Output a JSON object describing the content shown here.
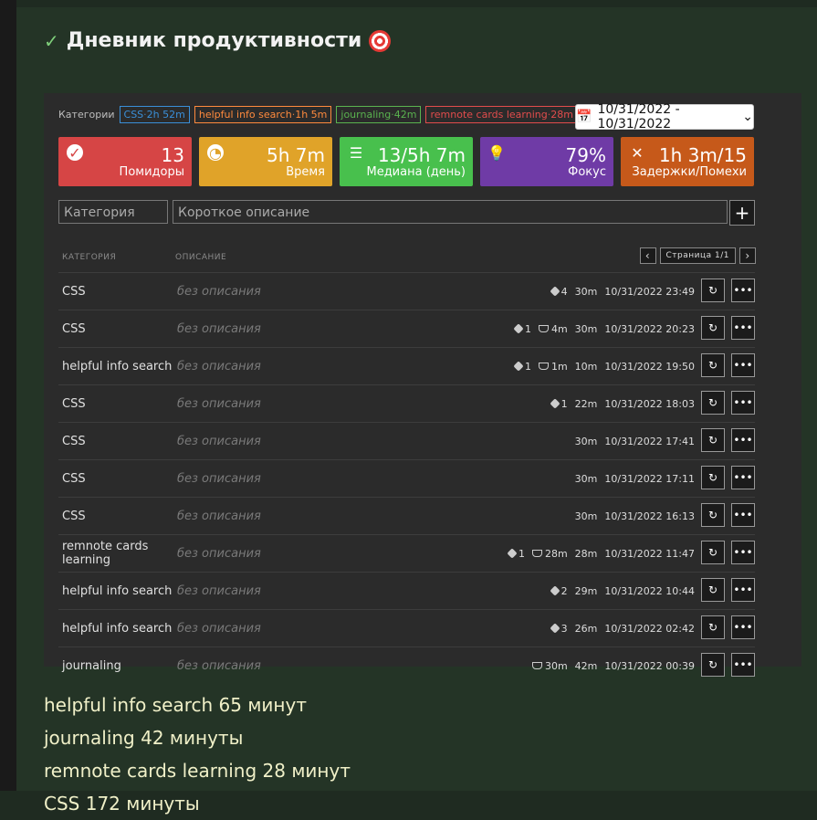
{
  "header": {
    "title": "Дневник продуктивности"
  },
  "filters": {
    "categories_label": "Категории",
    "chips": [
      {
        "name": "CSS",
        "time": "2h 52m",
        "color": "#3a8fd8"
      },
      {
        "name": "helpful info search",
        "time": "1h 5m",
        "color": "#ff8a3d"
      },
      {
        "name": "journaling",
        "time": "42m",
        "color": "#5ab34f"
      },
      {
        "name": "remnote cards learning",
        "time": "28m",
        "color": "#e24c4c"
      }
    ],
    "date_range": "10/31/2022 - 10/31/2022"
  },
  "stats": [
    {
      "value": "13",
      "label": "Помидоры",
      "color": "#d64545",
      "icon": "check-circle-icon"
    },
    {
      "value": "5h 7m",
      "label": "Время",
      "color": "#e0a329",
      "icon": "clock-icon"
    },
    {
      "value": "13/5h 7m",
      "label": "Медиана (день)",
      "color": "#48c04d",
      "icon": "list-icon"
    },
    {
      "value": "79%",
      "label": "Фокус",
      "color": "#6f3ba6",
      "icon": "bulb-icon"
    },
    {
      "value": "1h 3m/15",
      "label": "Задержки/Помехи",
      "color": "#c6591a",
      "icon": "close-icon"
    }
  ],
  "form": {
    "category_placeholder": "Категория",
    "description_placeholder": "Короткое описание"
  },
  "table": {
    "col_category": "КАТЕГОРИЯ",
    "col_description": "ОПИСАНИЕ",
    "pager_text": "Страница 1/1",
    "rows": [
      {
        "category": "CSS",
        "description": "без описания",
        "calls": "4",
        "cups": "",
        "duration": "30m",
        "datetime": "10/31/2022 23:49"
      },
      {
        "category": "CSS",
        "description": "без описания",
        "calls": "1",
        "cups": "4m",
        "duration": "30m",
        "datetime": "10/31/2022 20:23"
      },
      {
        "category": "helpful info search",
        "description": "без описания",
        "calls": "1",
        "cups": "1m",
        "duration": "10m",
        "datetime": "10/31/2022 19:50"
      },
      {
        "category": "CSS",
        "description": "без описания",
        "calls": "1",
        "cups": "",
        "duration": "22m",
        "datetime": "10/31/2022 18:03"
      },
      {
        "category": "CSS",
        "description": "без описания",
        "calls": "",
        "cups": "",
        "duration": "30m",
        "datetime": "10/31/2022 17:41"
      },
      {
        "category": "CSS",
        "description": "без описания",
        "calls": "",
        "cups": "",
        "duration": "30m",
        "datetime": "10/31/2022 17:11"
      },
      {
        "category": "CSS",
        "description": "без описания",
        "calls": "",
        "cups": "",
        "duration": "30m",
        "datetime": "10/31/2022 16:13"
      },
      {
        "category": "remnote cards learning",
        "description": "без описания",
        "calls": "1",
        "cups": "28m",
        "duration": "28m",
        "datetime": "10/31/2022 11:47"
      },
      {
        "category": "helpful info search",
        "description": "без описания",
        "calls": "2",
        "cups": "",
        "duration": "29m",
        "datetime": "10/31/2022 10:44"
      },
      {
        "category": "helpful info search",
        "description": "без описания",
        "calls": "3",
        "cups": "",
        "duration": "26m",
        "datetime": "10/31/2022 02:42"
      },
      {
        "category": "journaling",
        "description": "без описания",
        "calls": "",
        "cups": "30m",
        "duration": "42m",
        "datetime": "10/31/2022 00:39"
      }
    ]
  },
  "summary": [
    "helpful info search 65 минут",
    "journaling 42 минуты",
    "remnote cards learning 28 минут",
    "CSS 172 минуты"
  ]
}
